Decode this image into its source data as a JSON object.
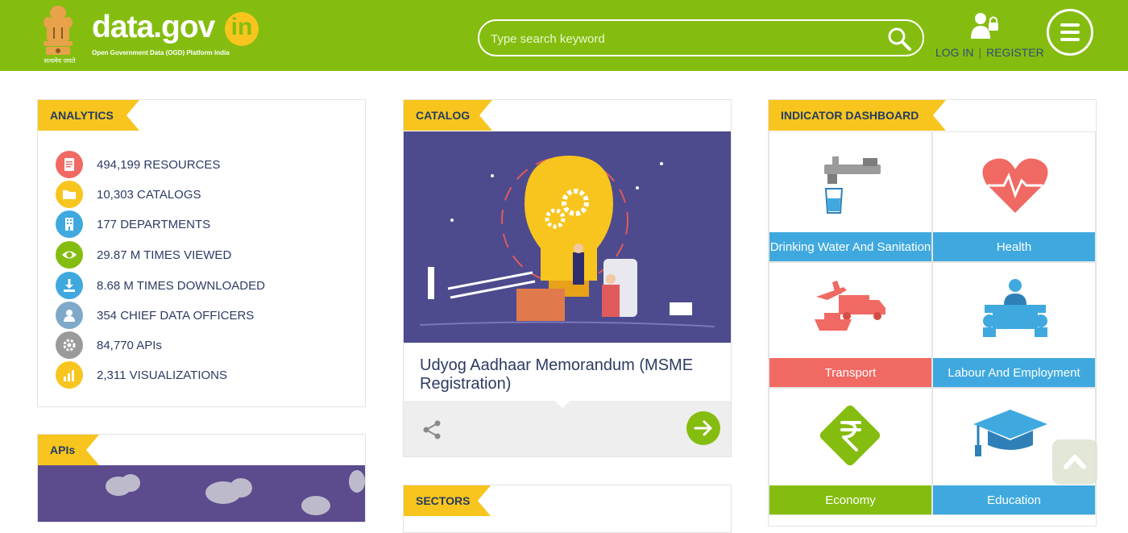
{
  "header": {
    "logo_text": "data.gov",
    "logo_suffix": "in",
    "tagline": "Open Government Data (OGD) Platform India",
    "emblem_caption": "सत्यमेव जयते",
    "search_placeholder": "Type search keyword",
    "login_label": "LOG IN",
    "separator": "|",
    "register_label": "REGISTER"
  },
  "analytics": {
    "title": "ANALYTICS",
    "items": [
      {
        "icon": "document-icon",
        "color": "#f06a63",
        "label": "494,199 RESOURCES"
      },
      {
        "icon": "folder-icon",
        "color": "#f7c51e",
        "label": "10,303 CATALOGS"
      },
      {
        "icon": "building-icon",
        "color": "#3fa9df",
        "label": "177 DEPARTMENTS"
      },
      {
        "icon": "eye-icon",
        "color": "#84bd0f",
        "label": "29.87 M TIMES VIEWED"
      },
      {
        "icon": "download-icon",
        "color": "#3fa9df",
        "label": "8.68 M TIMES DOWNLOADED"
      },
      {
        "icon": "person-icon",
        "color": "#7fa9c9",
        "label": "354 CHIEF DATA OFFICERS"
      },
      {
        "icon": "gear-icon",
        "color": "#9a9a9a",
        "label": "84,770 APIs"
      },
      {
        "icon": "bar-chart-icon",
        "color": "#f7c51e",
        "label": "2,311 VISUALIZATIONS"
      }
    ]
  },
  "apis": {
    "title": "APIs"
  },
  "catalog": {
    "title": "CATALOG",
    "featured_title": "Udyog Aadhaar Memorandum (MSME Registration)"
  },
  "sectors": {
    "title": "SECTORS"
  },
  "indicators": {
    "title": "INDICATOR DASHBOARD",
    "tiles": [
      {
        "label": "Drinking Water And Sanitation",
        "color": "#3fa9df",
        "icon": "water-tap-icon"
      },
      {
        "label": "Health",
        "color": "#3fa9df",
        "icon": "heart-icon"
      },
      {
        "label": "Transport",
        "color": "#f06a63",
        "icon": "transport-icon"
      },
      {
        "label": "Labour And Employment",
        "color": "#3fa9df",
        "icon": "labour-icon"
      },
      {
        "label": "Economy",
        "color": "#84bd0f",
        "icon": "rupee-icon"
      },
      {
        "label": "Education",
        "color": "#3fa9df",
        "icon": "graduation-cap-icon"
      }
    ]
  },
  "colors": {
    "brand_green": "#84bd0f",
    "ribbon_yellow": "#f7c51e",
    "text_navy": "#2d3b63"
  }
}
